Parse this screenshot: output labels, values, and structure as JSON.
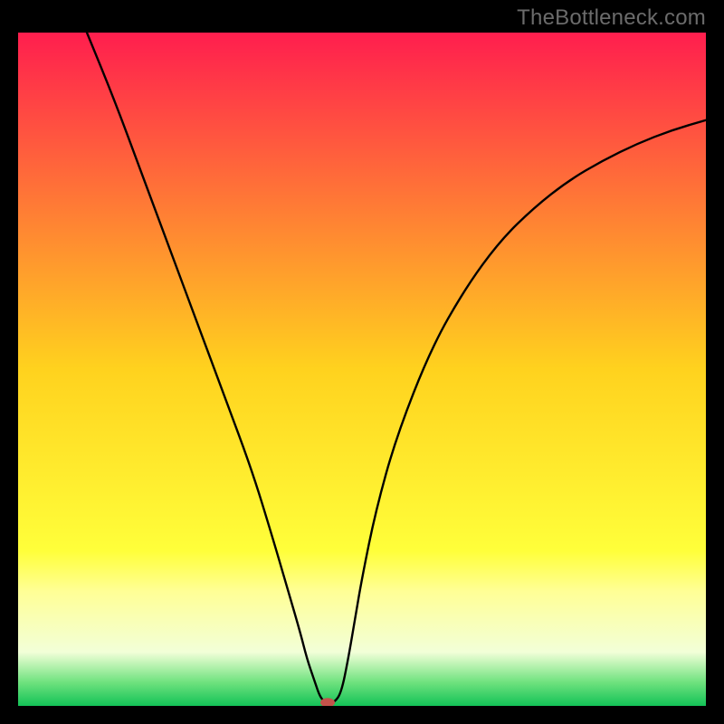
{
  "watermark": "TheBottleneck.com",
  "chart_data": {
    "type": "line",
    "title": "",
    "xlabel": "",
    "ylabel": "",
    "xlim": [
      0,
      100
    ],
    "ylim": [
      0,
      100
    ],
    "gradient": {
      "stops": [
        {
          "offset": 0.0,
          "color": "#ff1e4e"
        },
        {
          "offset": 0.5,
          "color": "#ffd21e"
        },
        {
          "offset": 0.77,
          "color": "#ffff3a"
        },
        {
          "offset": 0.83,
          "color": "#ffff96"
        },
        {
          "offset": 0.92,
          "color": "#f2ffd8"
        },
        {
          "offset": 0.965,
          "color": "#6fe27e"
        },
        {
          "offset": 1.0,
          "color": "#13c257"
        }
      ]
    },
    "series": [
      {
        "name": "bottleneck-curve",
        "color": "#000000",
        "x": [
          10,
          14,
          18,
          22,
          26,
          30,
          34,
          37,
          39,
          41,
          42,
          43,
          44,
          45,
          46,
          47,
          48,
          49,
          50,
          52,
          55,
          60,
          65,
          70,
          75,
          80,
          85,
          90,
          95,
          100
        ],
        "y": [
          100,
          90,
          79,
          68,
          57,
          46,
          35,
          25,
          18,
          11,
          7,
          4,
          1,
          0.5,
          0.5,
          2,
          7,
          13,
          19,
          29,
          40,
          53,
          62,
          69,
          74,
          78,
          81,
          83.5,
          85.5,
          87
        ]
      }
    ],
    "marker": {
      "name": "min-point",
      "x": 45,
      "y": 0.5,
      "color": "#c4534b",
      "rx": 8,
      "ry": 5
    }
  }
}
